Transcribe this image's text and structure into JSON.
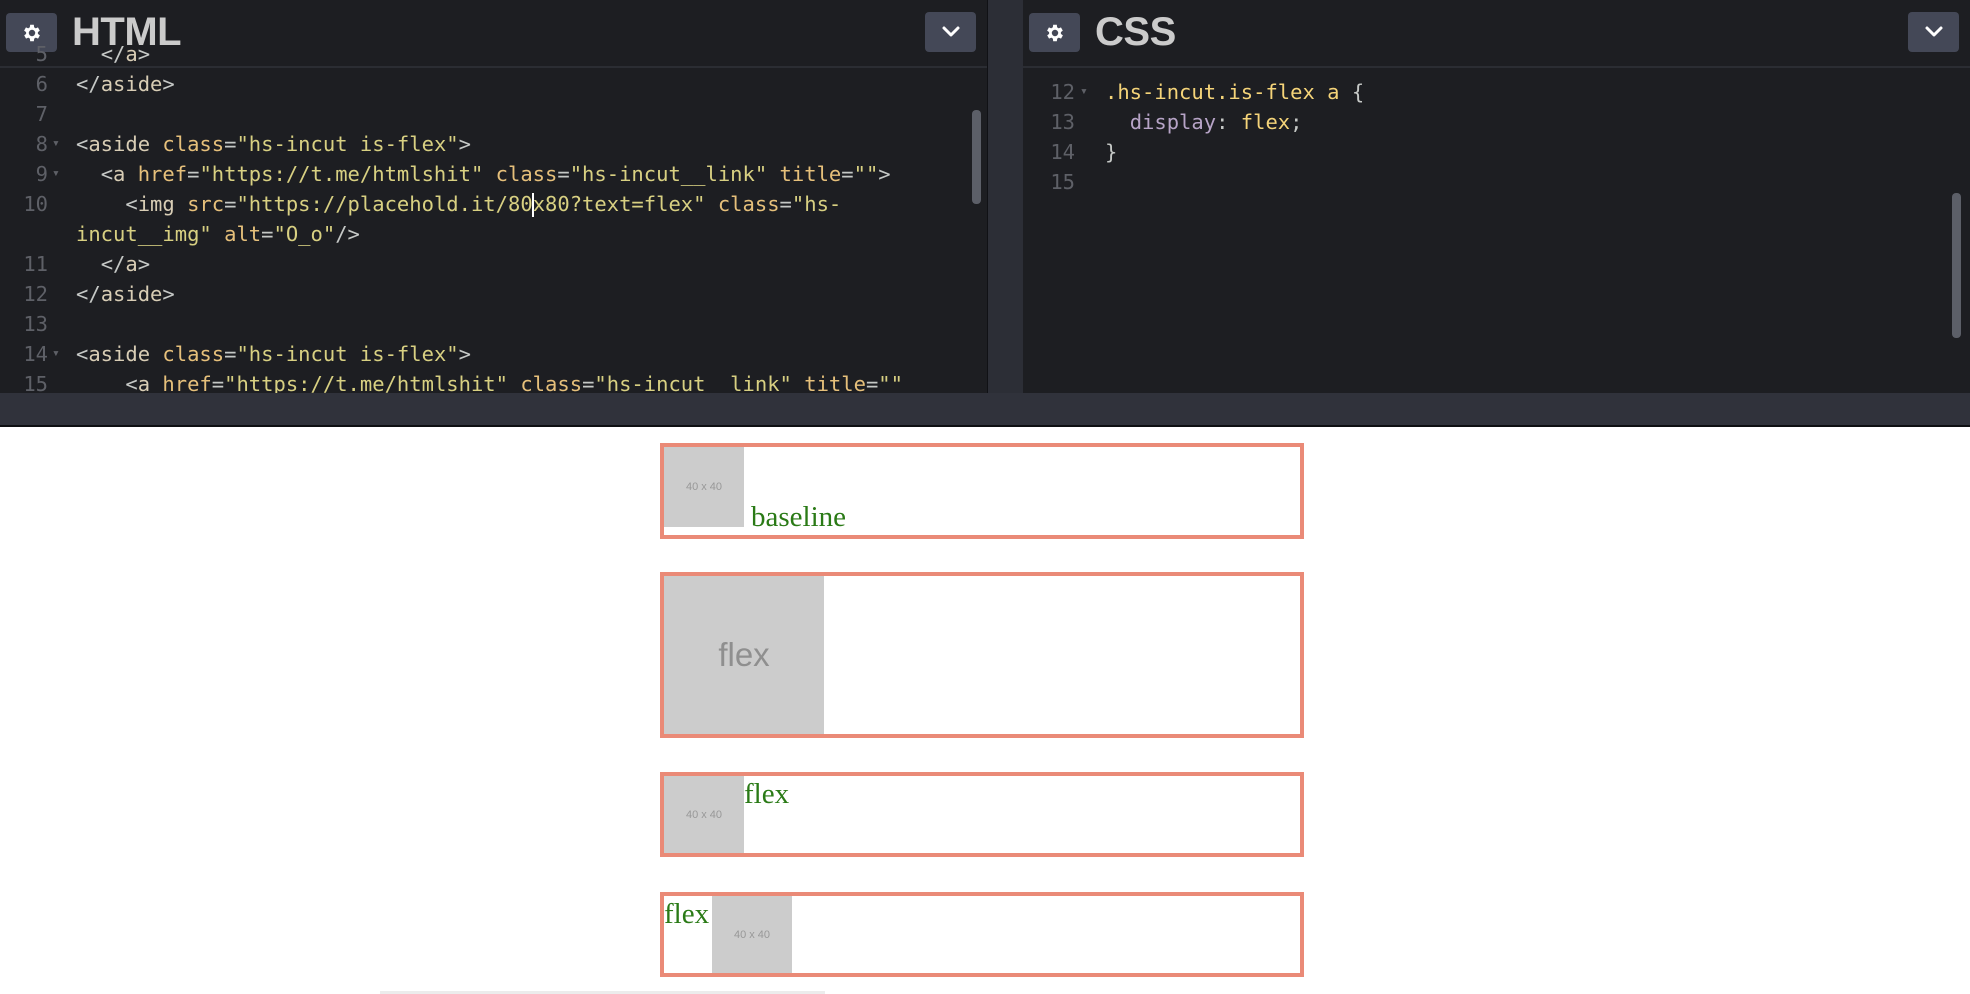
{
  "html_panel": {
    "title": "HTML",
    "lines": [
      {
        "n": "5",
        "fold": false,
        "segments": [
          [
            "t-plain",
            "  "
          ],
          [
            "t-tag",
            "</"
          ],
          [
            "t-name",
            "a"
          ],
          [
            "t-tag",
            ">"
          ]
        ]
      },
      {
        "n": "6",
        "fold": false,
        "segments": [
          [
            "t-tag",
            "</"
          ],
          [
            "t-name",
            "aside"
          ],
          [
            "t-tag",
            ">"
          ]
        ]
      },
      {
        "n": "7",
        "fold": false,
        "segments": []
      },
      {
        "n": "8",
        "fold": true,
        "segments": [
          [
            "t-tag",
            "<"
          ],
          [
            "t-name",
            "aside "
          ],
          [
            "t-attr",
            "class"
          ],
          [
            "t-tag",
            "="
          ],
          [
            "t-str",
            "\"hs-incut is-flex\""
          ],
          [
            "t-tag",
            ">"
          ]
        ]
      },
      {
        "n": "9",
        "fold": true,
        "segments": [
          [
            "t-plain",
            "  "
          ],
          [
            "t-tag",
            "<"
          ],
          [
            "t-name",
            "a "
          ],
          [
            "t-attr",
            "href"
          ],
          [
            "t-tag",
            "="
          ],
          [
            "t-str",
            "\"https://t.me/htmlshit\" "
          ],
          [
            "t-attr",
            "class"
          ],
          [
            "t-tag",
            "="
          ],
          [
            "t-str",
            "\"hs-incut__link\" "
          ],
          [
            "t-attr",
            "title"
          ],
          [
            "t-tag",
            "="
          ],
          [
            "t-str",
            "\"\""
          ],
          [
            "t-tag",
            ">"
          ]
        ]
      },
      {
        "n": "10",
        "fold": false,
        "cursor_after": 11,
        "segments": [
          [
            "t-plain",
            "    "
          ],
          [
            "t-tag",
            "<"
          ],
          [
            "t-name",
            "img "
          ],
          [
            "t-attr",
            "src"
          ],
          [
            "t-tag",
            "="
          ],
          [
            "t-str",
            "\"https://placehold.it/80"
          ],
          [
            "CURSOR",
            ""
          ],
          [
            "t-str",
            "x80?text=flex\" "
          ],
          [
            "t-attr",
            "class"
          ],
          [
            "t-tag",
            "="
          ],
          [
            "t-str",
            "\"hs-"
          ]
        ]
      },
      {
        "n": "",
        "fold": false,
        "segments": [
          [
            "t-str",
            "incut__img\" "
          ],
          [
            "t-attr",
            "alt"
          ],
          [
            "t-tag",
            "="
          ],
          [
            "t-str",
            "\"O_o\""
          ],
          [
            "t-tag",
            "/>"
          ]
        ]
      },
      {
        "n": "11",
        "fold": false,
        "segments": [
          [
            "t-plain",
            "  "
          ],
          [
            "t-tag",
            "</"
          ],
          [
            "t-name",
            "a"
          ],
          [
            "t-tag",
            ">"
          ]
        ]
      },
      {
        "n": "12",
        "fold": false,
        "segments": [
          [
            "t-tag",
            "</"
          ],
          [
            "t-name",
            "aside"
          ],
          [
            "t-tag",
            ">"
          ]
        ]
      },
      {
        "n": "13",
        "fold": false,
        "segments": []
      },
      {
        "n": "14",
        "fold": true,
        "segments": [
          [
            "t-tag",
            "<"
          ],
          [
            "t-name",
            "aside "
          ],
          [
            "t-attr",
            "class"
          ],
          [
            "t-tag",
            "="
          ],
          [
            "t-str",
            "\"hs-incut is-flex\""
          ],
          [
            "t-tag",
            ">"
          ]
        ]
      },
      {
        "n": "15",
        "fold": false,
        "segments": [
          [
            "t-plain",
            "    "
          ],
          [
            "t-tag",
            "<"
          ],
          [
            "t-name",
            "a "
          ],
          [
            "t-attr",
            "href"
          ],
          [
            "t-tag",
            "="
          ],
          [
            "t-str",
            "\"https://t.me/htmlshit\" "
          ],
          [
            "t-attr",
            "class"
          ],
          [
            "t-tag",
            "="
          ],
          [
            "t-str",
            "\"hs-incut__link\" "
          ],
          [
            "t-attr",
            "title"
          ],
          [
            "t-tag",
            "="
          ],
          [
            "t-str",
            "\"\""
          ]
        ]
      }
    ]
  },
  "css_panel": {
    "title": "CSS",
    "lines": [
      {
        "n": "12",
        "fold": true,
        "segments": [
          [
            "t-sel",
            ".hs-incut.is-flex a "
          ],
          [
            "t-plain",
            "{"
          ]
        ]
      },
      {
        "n": "13",
        "fold": false,
        "segments": [
          [
            "t-plain",
            "  "
          ],
          [
            "t-prop",
            "display"
          ],
          [
            "t-plain",
            ": "
          ],
          [
            "t-val",
            "flex"
          ],
          [
            "t-plain",
            ";"
          ]
        ]
      },
      {
        "n": "14",
        "fold": false,
        "segments": [
          [
            "t-plain",
            "}"
          ]
        ]
      },
      {
        "n": "15",
        "fold": false,
        "segments": []
      }
    ]
  },
  "icons": {
    "settings": "gear-icon",
    "collapse": "chevron-down-icon"
  },
  "colors": {
    "editor_bg": "#1d1e22",
    "button_bg": "#444857",
    "box_border": "#ea8a77",
    "label_green": "#2a7a16",
    "placeholder_bg": "#cccccc"
  },
  "preview": {
    "boxes": [
      {
        "image_text": "40 x 40",
        "label": "baseline"
      },
      {
        "image_text": "flex",
        "label": ""
      },
      {
        "image_text": "40 x 40",
        "label": "flex"
      },
      {
        "image_text": "40 x 40",
        "label": "flex"
      }
    ]
  }
}
